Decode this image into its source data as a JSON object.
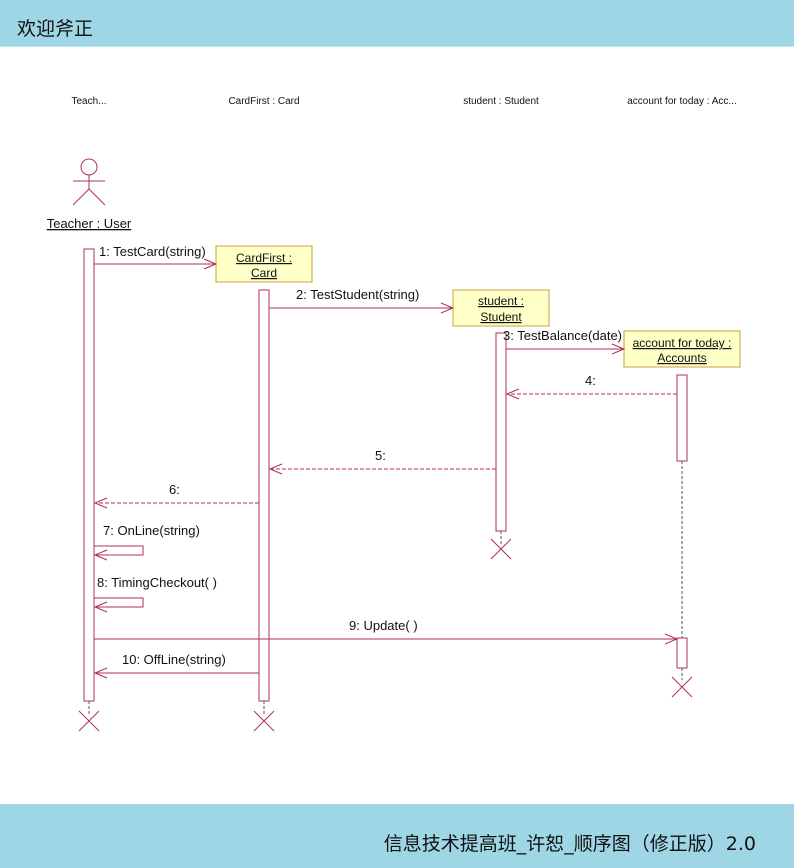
{
  "header": {
    "title": "欢迎斧正"
  },
  "footer": {
    "title": "信息技术提高班_许恕_顺序图（修正版）2.0"
  },
  "diagram": {
    "headers": [
      "Teach...",
      "CardFirst : Card",
      "student : Student",
      "account for today : Acc..."
    ],
    "actor_label": "Teacher : User",
    "objects": {
      "card": {
        "line1": "CardFirst :",
        "line2": "Card"
      },
      "student": {
        "line1": "student :",
        "line2": "Student"
      },
      "account": {
        "line1": "account for today :",
        "line2": "Accounts"
      }
    },
    "messages": [
      "1: TestCard(string)",
      "2: TestStudent(string)",
      "3: TestBalance(date)",
      "4:",
      "5:",
      "6:",
      "7: OnLine(string)",
      "8: TimingCheckout( )",
      "9: Update( )",
      "10: OffLine(string)"
    ],
    "colors": {
      "line": "#b0305a",
      "box_fill": "#ffffc8",
      "box_border": "#c8a040"
    }
  }
}
